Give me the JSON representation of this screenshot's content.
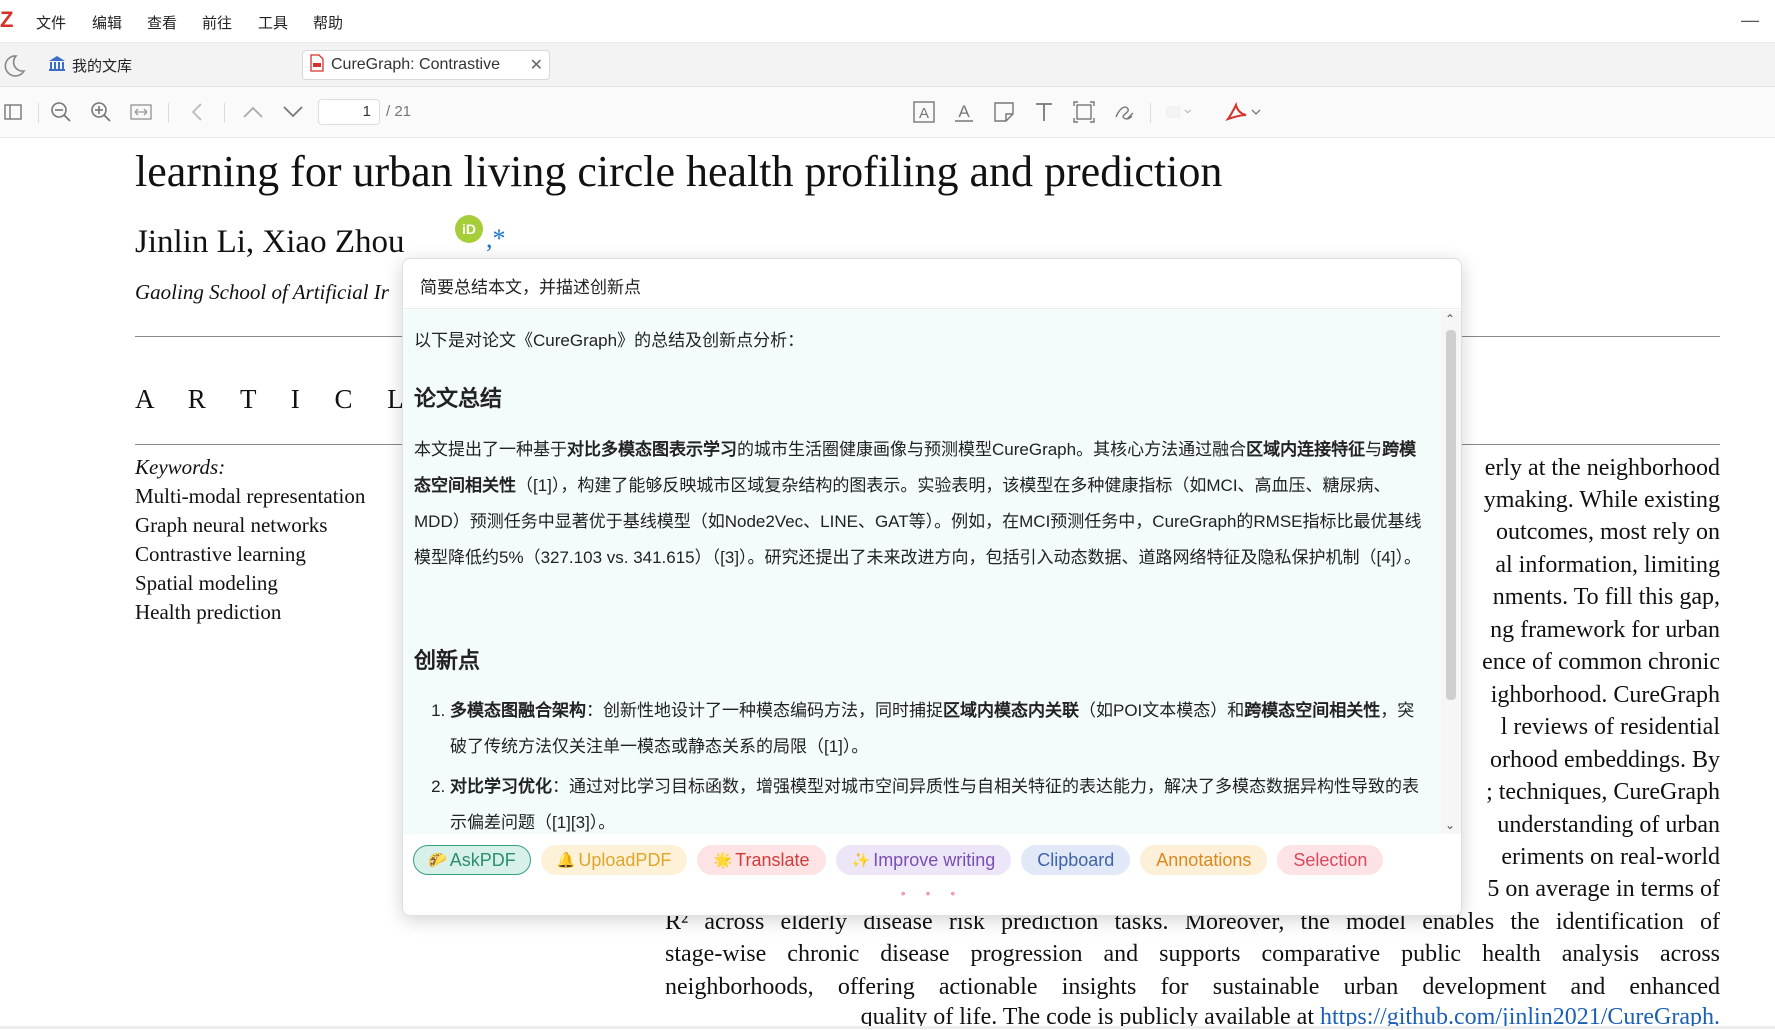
{
  "app": {
    "logo_letter": "Z"
  },
  "menubar": {
    "items": [
      "文件",
      "编辑",
      "查看",
      "前往",
      "工具",
      "帮助"
    ],
    "minimize_glyph": "—"
  },
  "tabs": {
    "library_label": "我的文库",
    "paper_tab_label": "CureGraph: Contrastive",
    "close_glyph": "✕"
  },
  "toolbar": {
    "page_current": "1",
    "page_total": "/ 21"
  },
  "pdf": {
    "title_line": "learning for urban living circle health profiling and prediction",
    "authors": "Jinlin Li, Xiao Zhou",
    "orcid_label": "iD",
    "author_mark": ",*",
    "affiliation": "Gaoling School of Artificial Ir",
    "article_info_heading": "A R T I C L E   I",
    "keywords_label": "Keywords:",
    "keywords": [
      "Multi-modal representation",
      "Graph neural networks",
      "Contrastive learning",
      "Spatial modeling",
      "Health prediction"
    ],
    "abstract_right_fragments": [
      "erly at the neighborhood",
      "ymaking. While existing",
      "outcomes, most rely on",
      "al information, limiting",
      "nments. To fill this gap,",
      "ng framework for urban",
      "ence of common chronic",
      "ighborhood. CureGraph",
      "l reviews of residential",
      "orhood embeddings. By",
      "; techniques, CureGraph",
      "understanding of urban",
      "eriments on real-world",
      "5 on average in terms of"
    ],
    "abstract_full_lines": [
      "R² across elderly disease risk prediction tasks. Moreover, the model enables the identification of",
      "stage-wise chronic disease progression and supports comparative public health analysis across",
      "neighborhoods, offering actionable insights for sustainable urban development and enhanced"
    ],
    "last_line_text": "quality of life. The code is publicly available at ",
    "code_link": "https://github.com/jinlin2021/CureGraph."
  },
  "ai_popup": {
    "prompt": "简要总结本文，并描述创新点",
    "intro": "以下是对论文《CureGraph》的总结及创新点分析：",
    "summary_heading": "论文总结",
    "summary_parts": [
      "本文提出了一种基于",
      "对比多模态图表示学习",
      "的城市生活圈健康画像与预测模型CureGraph。其核心方法通过融合",
      "区域内连接特征",
      "与",
      "跨模态空间相关性",
      "（[1]），构建了能够反映城市区域复杂结构的图表示。实验表明，该模型在多种健康指标（如MCI、高血压、糖尿病、MDD）预测任务中显著优于基线模型（如Node2Vec、LINE、GAT等）。例如，在MCI预测任务中，CureGraph的RMSE指标比最优基线模型降低约5%（327.103 vs. 341.615）（[3]）。研究还提出了未来改进方向，包括引入动态数据、道路网络特征及隐私保护机制（[4]）。"
    ],
    "innovation_heading": "创新点",
    "innovations": [
      {
        "title": "多模态图融合架构",
        "parts": [
          "：创新性地设计了一种模态编码方法，同时捕捉",
          "区域内模态内关联",
          "（如POI文本模态）和",
          "跨模态空间相关性",
          "，突破了传统方法仅关注单一模态或静态关系的局限（[1]）。"
        ]
      },
      {
        "title": "对比学习优化",
        "parts": [
          "：通过对比学习目标函数，增强模型对城市空间异质性与自相关特征的表达能力，解决了多模态数据异构性导致的表示偏差问题（[1][3]）。"
        ]
      }
    ],
    "scroll_up": "⌃",
    "scroll_down": "⌄",
    "chips": [
      {
        "label": "AskPDF",
        "icon": "🌮"
      },
      {
        "label": "UploadPDF",
        "icon": "🔔"
      },
      {
        "label": "Translate",
        "icon": "🌟"
      },
      {
        "label": "Improve writing",
        "icon": "✨"
      },
      {
        "label": "Clipboard",
        "icon": ""
      },
      {
        "label": "Annotations",
        "icon": ""
      },
      {
        "label": "Selection",
        "icon": ""
      }
    ],
    "pager_dots": "• • •"
  },
  "colors": {
    "accent_red": "#d6322b",
    "response_bg": "#f3fbfb",
    "link": "#1a5fb4"
  }
}
